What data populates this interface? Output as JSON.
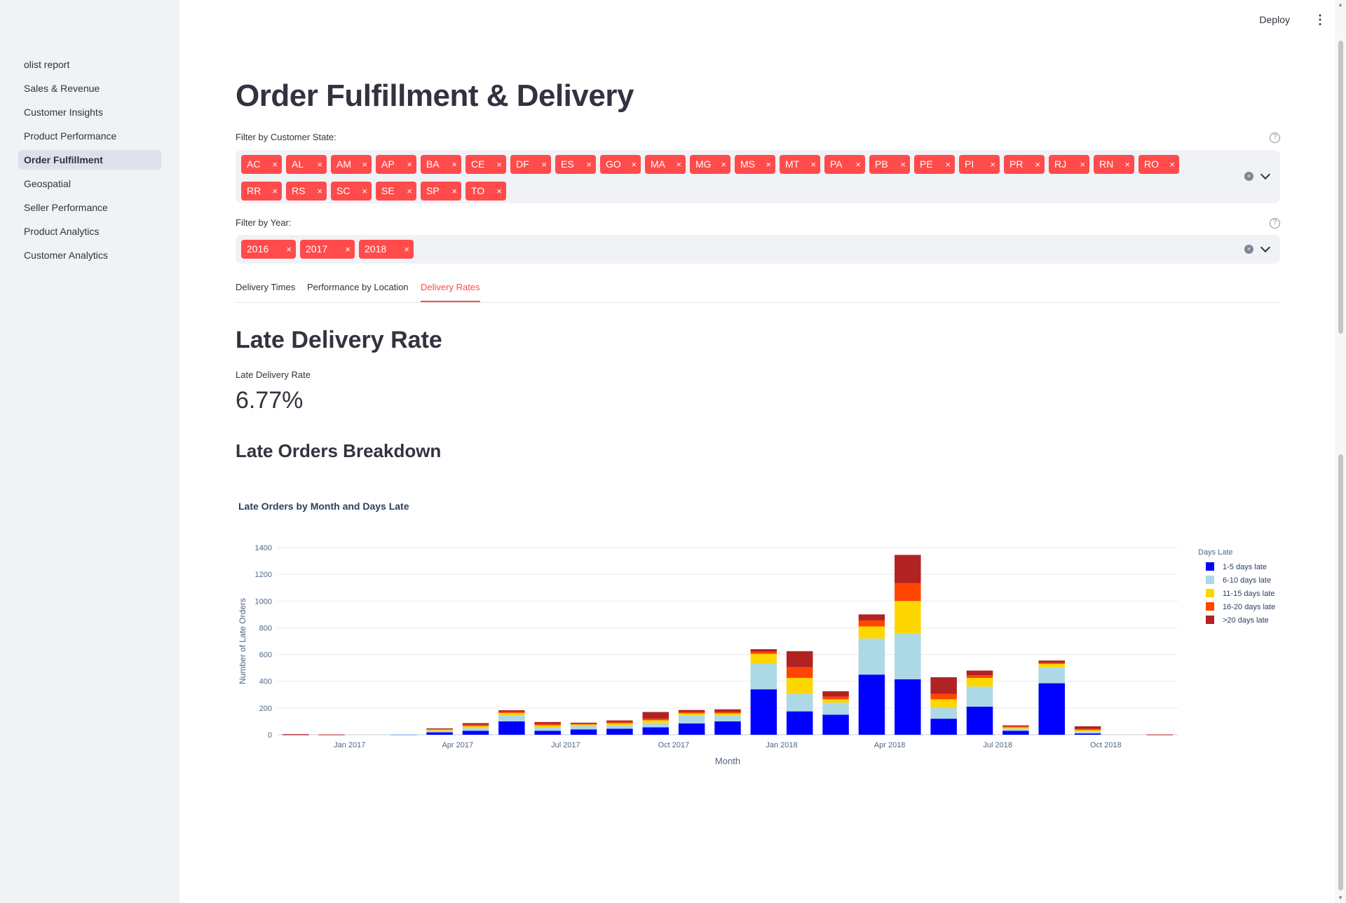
{
  "sidebar": {
    "items": [
      {
        "label": "olist report",
        "active": false
      },
      {
        "label": "Sales & Revenue",
        "active": false
      },
      {
        "label": "Customer Insights",
        "active": false
      },
      {
        "label": "Product Performance",
        "active": false
      },
      {
        "label": "Order Fulfillment",
        "active": true
      },
      {
        "label": "Geospatial",
        "active": false
      },
      {
        "label": "Seller Performance",
        "active": false
      },
      {
        "label": "Product Analytics",
        "active": false
      },
      {
        "label": "Customer Analytics",
        "active": false
      }
    ]
  },
  "topbar": {
    "deploy_label": "Deploy",
    "menu_icon": "vertical-dots-icon"
  },
  "page": {
    "title": "Order Fulfillment & Delivery"
  },
  "filters": {
    "state": {
      "label": "Filter by Customer State:",
      "tags": [
        "AC",
        "AL",
        "AM",
        "AP",
        "BA",
        "CE",
        "DF",
        "ES",
        "GO",
        "MA",
        "MG",
        "MS",
        "MT",
        "PA",
        "PB",
        "PE",
        "PI",
        "PR",
        "RJ",
        "RN",
        "RO",
        "RR",
        "RS",
        "SC",
        "SE",
        "SP",
        "TO"
      ]
    },
    "year": {
      "label": "Filter by Year:",
      "tags": [
        "2016",
        "2017",
        "2018"
      ]
    },
    "tag_close_glyph": "×",
    "help_glyph": "?",
    "clear_glyph": "×"
  },
  "tabs": [
    {
      "label": "Delivery Times",
      "active": false
    },
    {
      "label": "Performance by Location",
      "active": false
    },
    {
      "label": "Delivery Rates",
      "active": true
    }
  ],
  "late_delivery": {
    "heading": "Late Delivery Rate",
    "metric_label": "Late Delivery Rate",
    "metric_value": "6.77%"
  },
  "breakdown": {
    "heading": "Late Orders Breakdown"
  },
  "colors": {
    "accent": "#ff4b4b",
    "series": [
      "#0000ff",
      "#add8e6",
      "#ffd700",
      "#ff4500",
      "#b22222"
    ]
  },
  "chart_data": {
    "type": "bar",
    "stacked": true,
    "title": "Late Orders by Month and Days Late",
    "xlabel": "Month",
    "ylabel": "Number of Late Orders",
    "ylim": [
      0,
      1400
    ],
    "yticks": [
      0,
      200,
      400,
      600,
      800,
      1000,
      1200,
      1400
    ],
    "xtick_labels": [
      {
        "label": "Jan 2017",
        "index": 2
      },
      {
        "label": "Apr 2017",
        "index": 5
      },
      {
        "label": "Jul 2017",
        "index": 8
      },
      {
        "label": "Oct 2017",
        "index": 11
      },
      {
        "label": "Jan 2018",
        "index": 14
      },
      {
        "label": "Apr 2018",
        "index": 17
      },
      {
        "label": "Jul 2018",
        "index": 20
      },
      {
        "label": "Oct 2018",
        "index": 23
      }
    ],
    "categories": [
      "2016-10",
      "2016-11",
      "2016-12",
      "2017-01",
      "2017-02",
      "2017-03",
      "2017-04",
      "2017-05",
      "2017-06",
      "2017-07",
      "2017-08",
      "2017-09",
      "2017-10",
      "2017-11",
      "2017-12",
      "2018-01",
      "2018-02",
      "2018-03",
      "2018-04",
      "2018-05",
      "2018-06",
      "2018-07",
      "2018-08",
      "2018-09",
      "2018-10"
    ],
    "legend_title": "Days Late",
    "legend_position": "right",
    "grid": true,
    "series": [
      {
        "name": "1-5 days late",
        "values": [
          2,
          0,
          0,
          3,
          18,
          30,
          100,
          30,
          40,
          45,
          55,
          85,
          100,
          340,
          175,
          150,
          450,
          415,
          120,
          210,
          30,
          385,
          10,
          0,
          0
        ]
      },
      {
        "name": "6-10 days late",
        "values": [
          0,
          0,
          0,
          1,
          12,
          20,
          45,
          25,
          25,
          25,
          35,
          60,
          45,
          190,
          130,
          90,
          270,
          345,
          80,
          150,
          15,
          120,
          15,
          0,
          0
        ]
      },
      {
        "name": "11-15 days late",
        "values": [
          0,
          0,
          0,
          0,
          8,
          15,
          18,
          15,
          12,
          15,
          18,
          15,
          15,
          75,
          120,
          25,
          90,
          240,
          65,
          65,
          10,
          25,
          10,
          0,
          0
        ]
      },
      {
        "name": "16-20 days late",
        "values": [
          1,
          0,
          0,
          0,
          5,
          10,
          10,
          10,
          5,
          10,
          12,
          10,
          10,
          15,
          80,
          20,
          45,
          135,
          40,
          20,
          7,
          10,
          8,
          0,
          0
        ]
      },
      {
        "name": ">20 days late",
        "values": [
          1,
          2,
          0,
          0,
          5,
          12,
          10,
          15,
          8,
          12,
          50,
          15,
          20,
          20,
          120,
          40,
          45,
          210,
          125,
          35,
          8,
          15,
          20,
          0,
          2
        ]
      }
    ]
  }
}
